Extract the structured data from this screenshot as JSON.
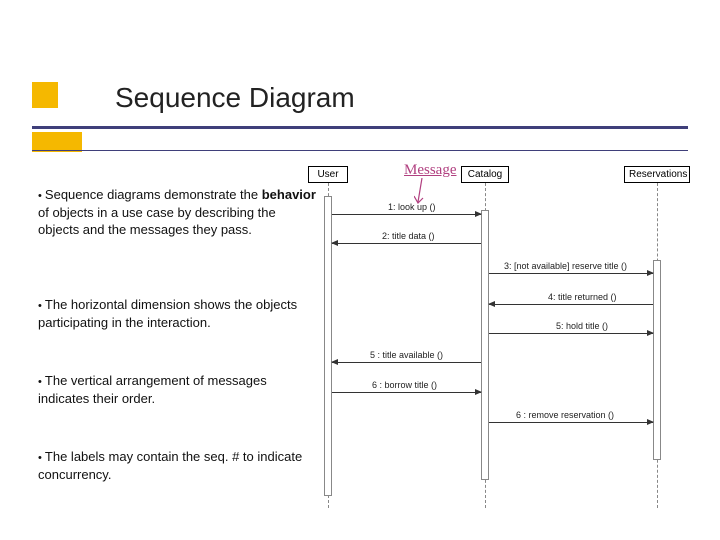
{
  "title": "Sequence Diagram",
  "message_label": "Message",
  "bullets": {
    "b1_pre": "Sequence diagrams demonstrate the ",
    "b1_bold": "behavior",
    "b1_post": " of objects in a use case by describing the objects and the messages they pass.",
    "b2": "The horizontal dimension shows the objects participating in the interaction.",
    "b3": "The vertical arrangement of messages indicates their order.",
    "b4": "The labels may contain the seq. #  to indicate concurrency."
  },
  "objects": {
    "user": "User",
    "catalog": "Catalog",
    "reservations": "Reservations"
  },
  "messages": {
    "m1": "1: look up ()",
    "m2": "2: title data ()",
    "m3": "3: [not available] reserve title ()",
    "m4": "4: title returned ()",
    "m5": "5: hold title ()",
    "m6": "5 : title available ()",
    "m7": "6 : borrow title ()",
    "m8": "6 : remove reservation ()"
  }
}
